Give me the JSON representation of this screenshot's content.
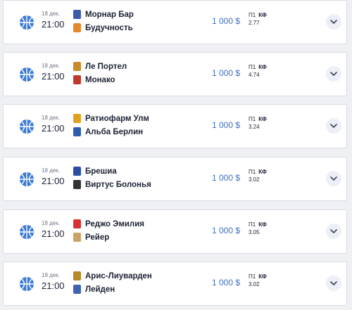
{
  "matches": [
    {
      "date": "18 дек.",
      "time": "21:00",
      "team1": "Морнар Бар",
      "team2": "Будучность",
      "amount": "1 000 $",
      "market": "П1",
      "kf_label": "КФ",
      "kf": "2.77",
      "logo1_color": "#3b5aa8",
      "logo2_color": "#e08a2a"
    },
    {
      "date": "18 дек.",
      "time": "21:00",
      "team1": "Ле Портел",
      "team2": "Монако",
      "amount": "1 000 $",
      "market": "П1",
      "kf_label": "КФ",
      "kf": "4.74",
      "logo1_color": "#c98a2a",
      "logo2_color": "#c0392b"
    },
    {
      "date": "18 дек.",
      "time": "21:00",
      "team1": "Ратиофарм Улм",
      "team2": "Альба Берлин",
      "amount": "1 000 $",
      "market": "П1",
      "kf_label": "КФ",
      "kf": "3.24",
      "logo1_color": "#e0a020",
      "logo2_color": "#2e5eaa"
    },
    {
      "date": "18 дек.",
      "time": "21:00",
      "team1": "Брешиа",
      "team2": "Виртус Болонья",
      "amount": "1 000 $",
      "market": "П1",
      "kf_label": "КФ",
      "kf": "3.02",
      "logo1_color": "#2a4ea0",
      "logo2_color": "#333333"
    },
    {
      "date": "18 дек.",
      "time": "21:00",
      "team1": "Реджо Эмилия",
      "team2": "Рейер",
      "amount": "1 000 $",
      "market": "П1",
      "kf_label": "КФ",
      "kf": "3.05",
      "logo1_color": "#d6322f",
      "logo2_color": "#c9a46a"
    },
    {
      "date": "18 дек.",
      "time": "21:00",
      "team1": "Арис-Лиуварден",
      "team2": "Лейден",
      "amount": "1 000 $",
      "market": "П1",
      "kf_label": "КФ",
      "kf": "3.02",
      "logo1_color": "#b8892b",
      "logo2_color": "#3f62b3"
    }
  ],
  "colors": {
    "accent": "#3e6fc0",
    "icon": "#3a7bd5",
    "page_bg": "#eef0f4"
  },
  "icons": {
    "sport": "basketball-icon",
    "expand": "chevron-down-icon"
  }
}
